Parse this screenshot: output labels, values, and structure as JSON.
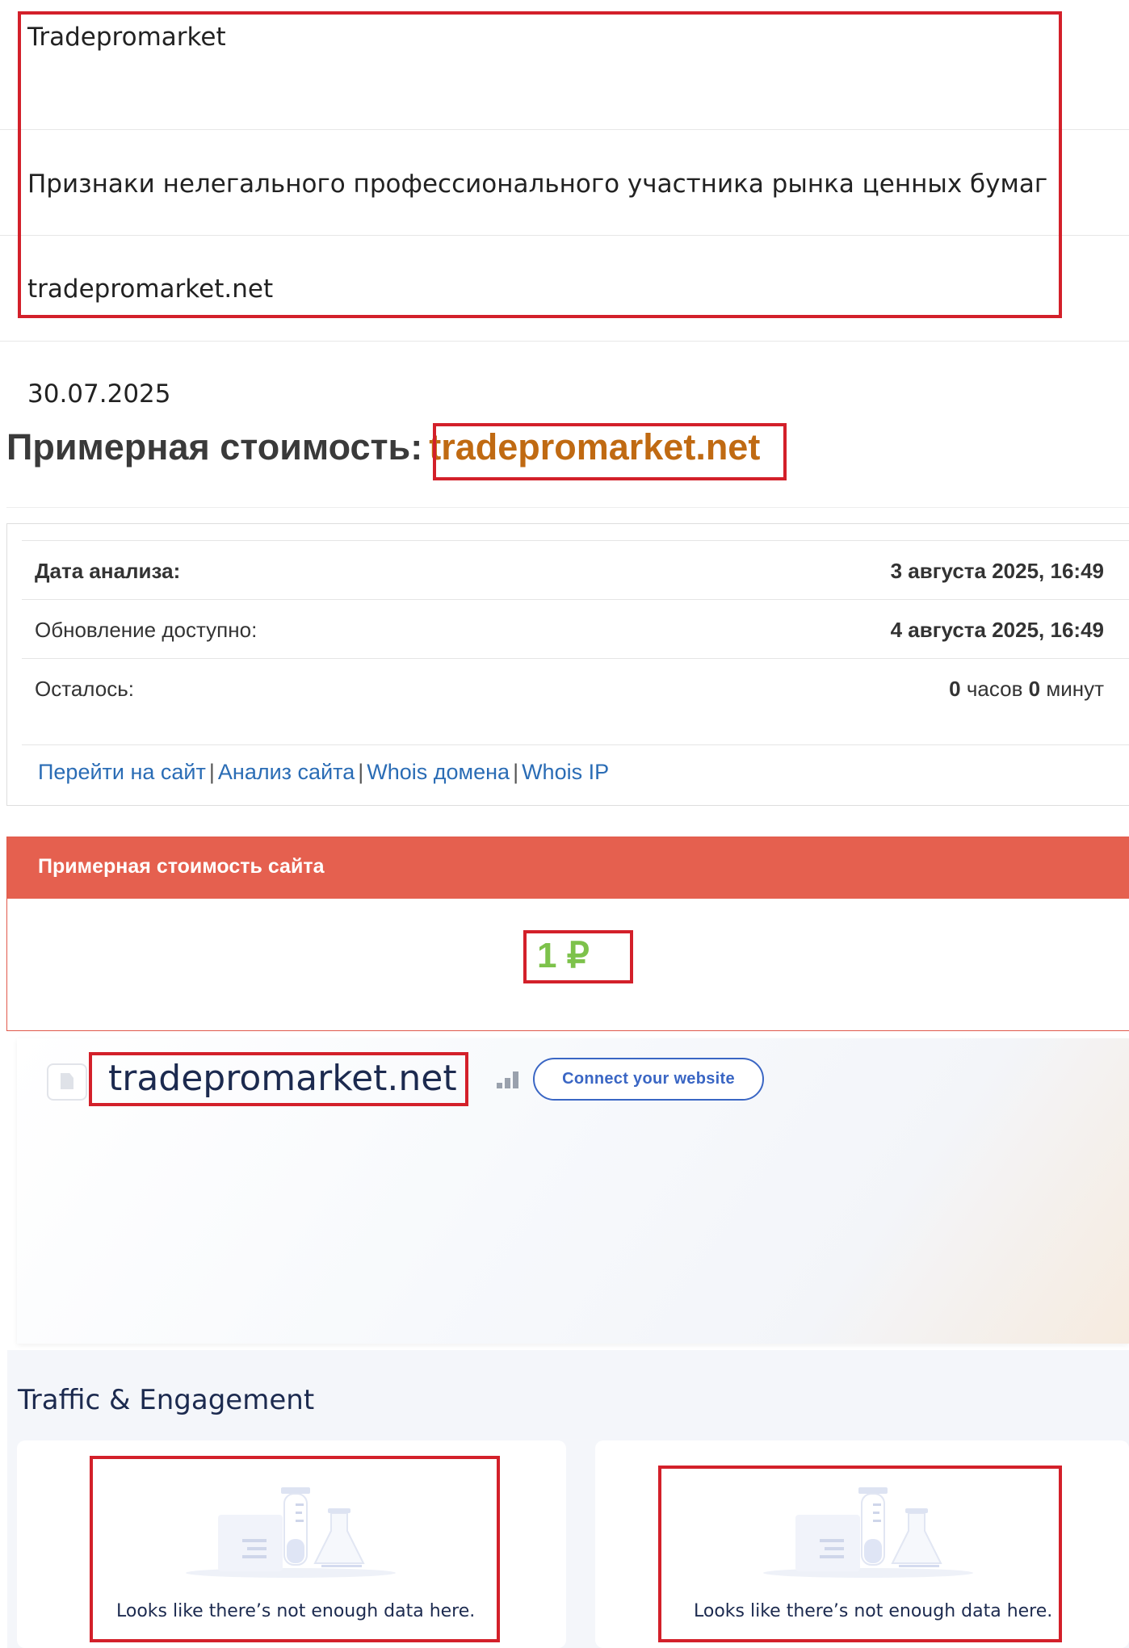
{
  "top_info": {
    "name": "Tradepromarket",
    "category": "Признаки нелегального профессионального участника рынка ценных бумаг",
    "domain": "tradepromarket.net"
  },
  "date": "30.07.2025",
  "cost_heading": {
    "label": "Примерная стоимость:",
    "domain": "tradepromarket.net"
  },
  "analysis": {
    "rows": [
      {
        "label": "Дата анализа:",
        "value": "3 августа 2025, 16:49"
      },
      {
        "label": "Обновление доступно:",
        "value": "4 августа 2025, 16:49"
      },
      {
        "label": "Осталось:",
        "hours": "0",
        "hours_unit": "часов",
        "minutes": "0",
        "minutes_unit": "минут"
      }
    ],
    "links": [
      "Перейти на сайт",
      "Анализ сайта",
      "Whois домена",
      "Whois IP"
    ]
  },
  "estimate": {
    "header": "Примерная стоимость сайта",
    "value": "1 ₽"
  },
  "site_card": {
    "domain": "tradepromarket.net",
    "connect_label": "Connect your website"
  },
  "traffic": {
    "title": "Traffic & Engagement",
    "empty_left": "Looks like there’s not enough data here.",
    "empty_right": "Looks like there’s not enough data here."
  },
  "colors": {
    "highlight_box": "#d3202a",
    "domain_orange": "#c06a12",
    "link_blue": "#2a6cb5",
    "estimate_header": "#e5604f",
    "estimate_value": "#7dc24b",
    "navy_text": "#1c2a4f"
  }
}
